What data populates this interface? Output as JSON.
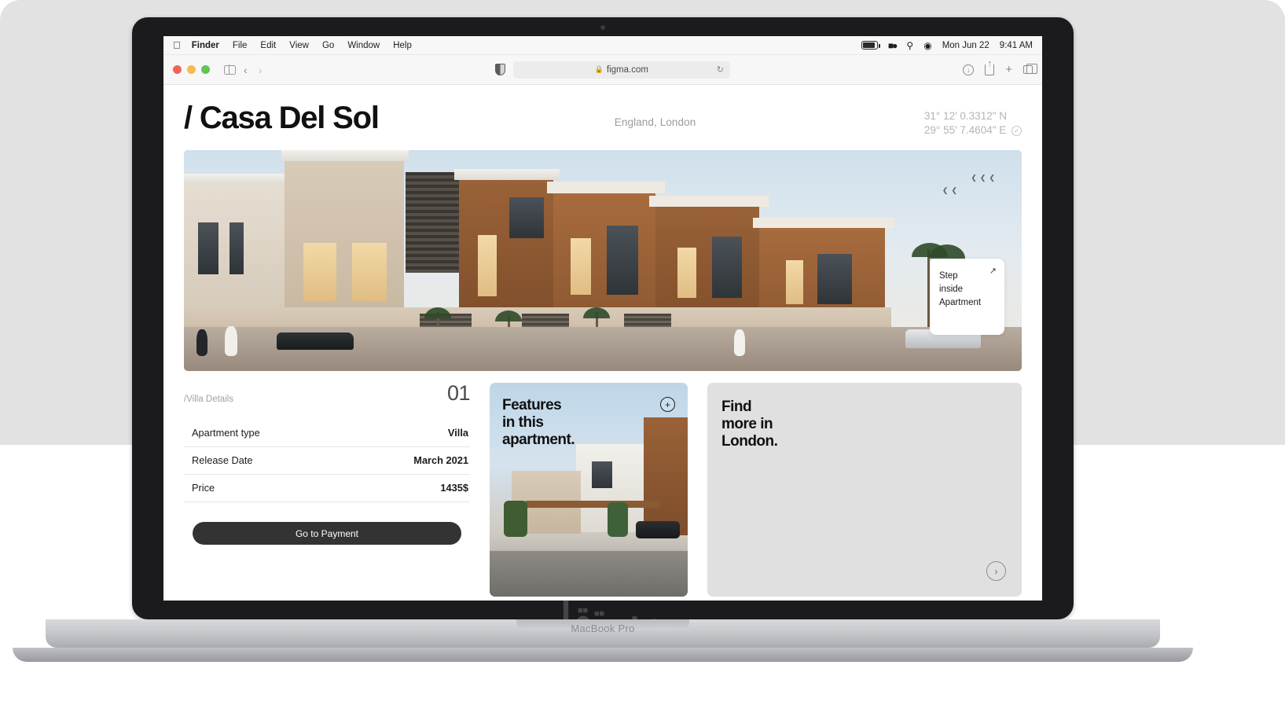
{
  "menubar": {
    "apple_icon": "apple-icon",
    "items": [
      {
        "label": "Finder",
        "bold": true
      },
      {
        "label": "File",
        "bold": false
      },
      {
        "label": "Edit",
        "bold": false
      },
      {
        "label": "View",
        "bold": false
      },
      {
        "label": "Go",
        "bold": false
      },
      {
        "label": "Window",
        "bold": false
      },
      {
        "label": "Help",
        "bold": false
      }
    ],
    "tray": {
      "battery_icon": "battery-icon",
      "controlcenter_icon": "control-center-icon",
      "search_icon": "search-icon",
      "wifi_icon": "wifi-icon",
      "date": "Mon Jun 22",
      "time": "9:41 AM"
    }
  },
  "browser": {
    "traffic_lights": [
      "close",
      "minimize",
      "zoom"
    ],
    "sidebar_icon": "sidebar-toggle-icon",
    "back_icon": "‹",
    "forward_icon": "›",
    "shield_icon": "privacy-shield-icon",
    "url": "figma.com",
    "lock_icon": "🔒",
    "reload_icon": "↻",
    "download_icon": "download-icon",
    "share_icon": "share-icon",
    "newtab_icon": "+",
    "tabs_icon": "tab-overview-icon"
  },
  "page": {
    "title": "/ Casa Del Sol",
    "location": "England, London",
    "coordinates": {
      "lat": "31° 12' 0.3312\" N",
      "lon": "29° 55' 7.4604\" E",
      "verified_icon": "✓"
    },
    "hero": {
      "step_card": {
        "line1": "Step",
        "line2": "inside",
        "line3": "Apartment",
        "expand_icon": "↗"
      }
    },
    "details": {
      "section_label": "/Villa Details",
      "section_number": "01",
      "rows": [
        {
          "label": "Apartment type",
          "value": "Villa"
        },
        {
          "label": "Release Date",
          "value": "March 2021"
        },
        {
          "label": "Price",
          "value": "1435$"
        }
      ],
      "payment_button": "Go to Payment"
    },
    "features_card": {
      "line1": "Features",
      "line2": "in this",
      "line3": "apartment.",
      "add_icon": "+"
    },
    "find_card": {
      "line1": "Find",
      "line2": "more in",
      "line3": "London.",
      "arrow_icon": "›"
    }
  },
  "device": {
    "model": "MacBook Pro",
    "watermark": "مستقل"
  }
}
